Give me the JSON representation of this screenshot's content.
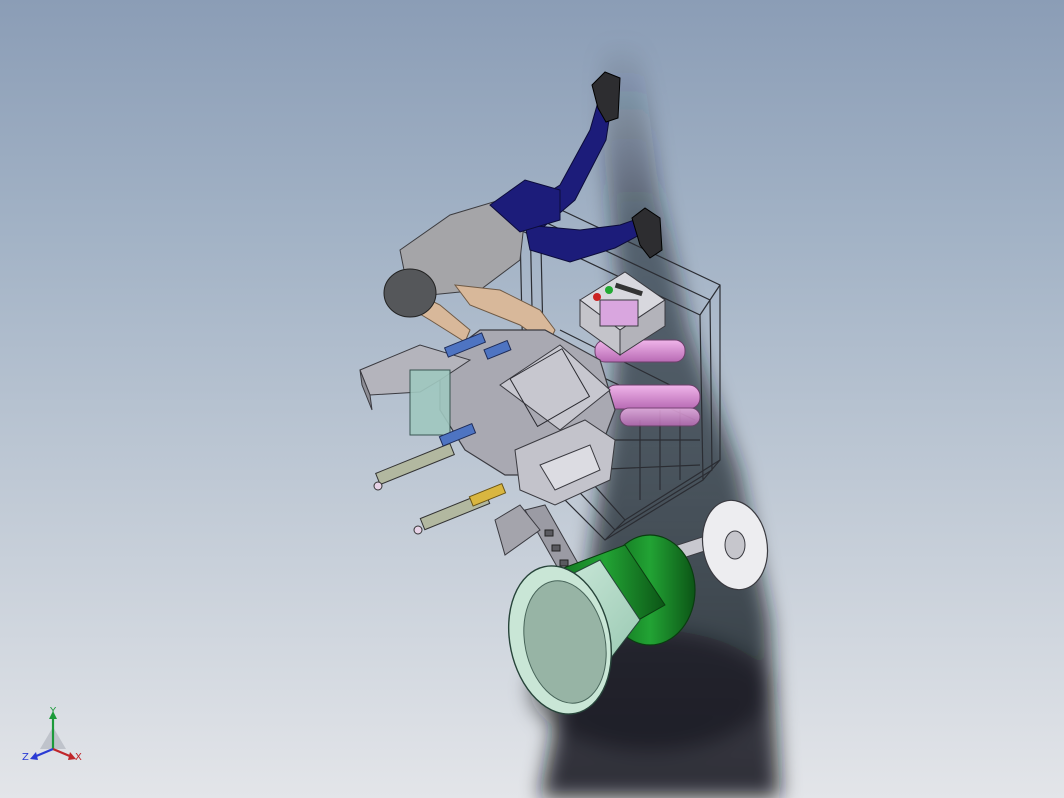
{
  "scene": {
    "model_name": "",
    "colors": {
      "bg_top": "#8b9db6",
      "bg_bottom": "#e3e5e9",
      "frame_gray": "#b9b9c2",
      "plate_gray": "#a5a5ad",
      "pink_roll": "#d98bd6",
      "green_drum": "#1c8c2a",
      "mint_drum": "#b4dcc8",
      "blue_suit": "#1c1c7a",
      "skin": "#d8b89a",
      "head": "#55575a"
    },
    "parts": [
      "operator-figure",
      "wire-frame",
      "control-box",
      "rotary-plate",
      "pneumatic-cylinders",
      "feed-chute",
      "roll-drum",
      "spool-reel"
    ]
  },
  "triad": {
    "x_label": "X",
    "y_label": "Y",
    "z_label": "Z",
    "x_color": "#c0262a",
    "y_color": "#1c9a3a",
    "z_color": "#2a3bd4"
  }
}
